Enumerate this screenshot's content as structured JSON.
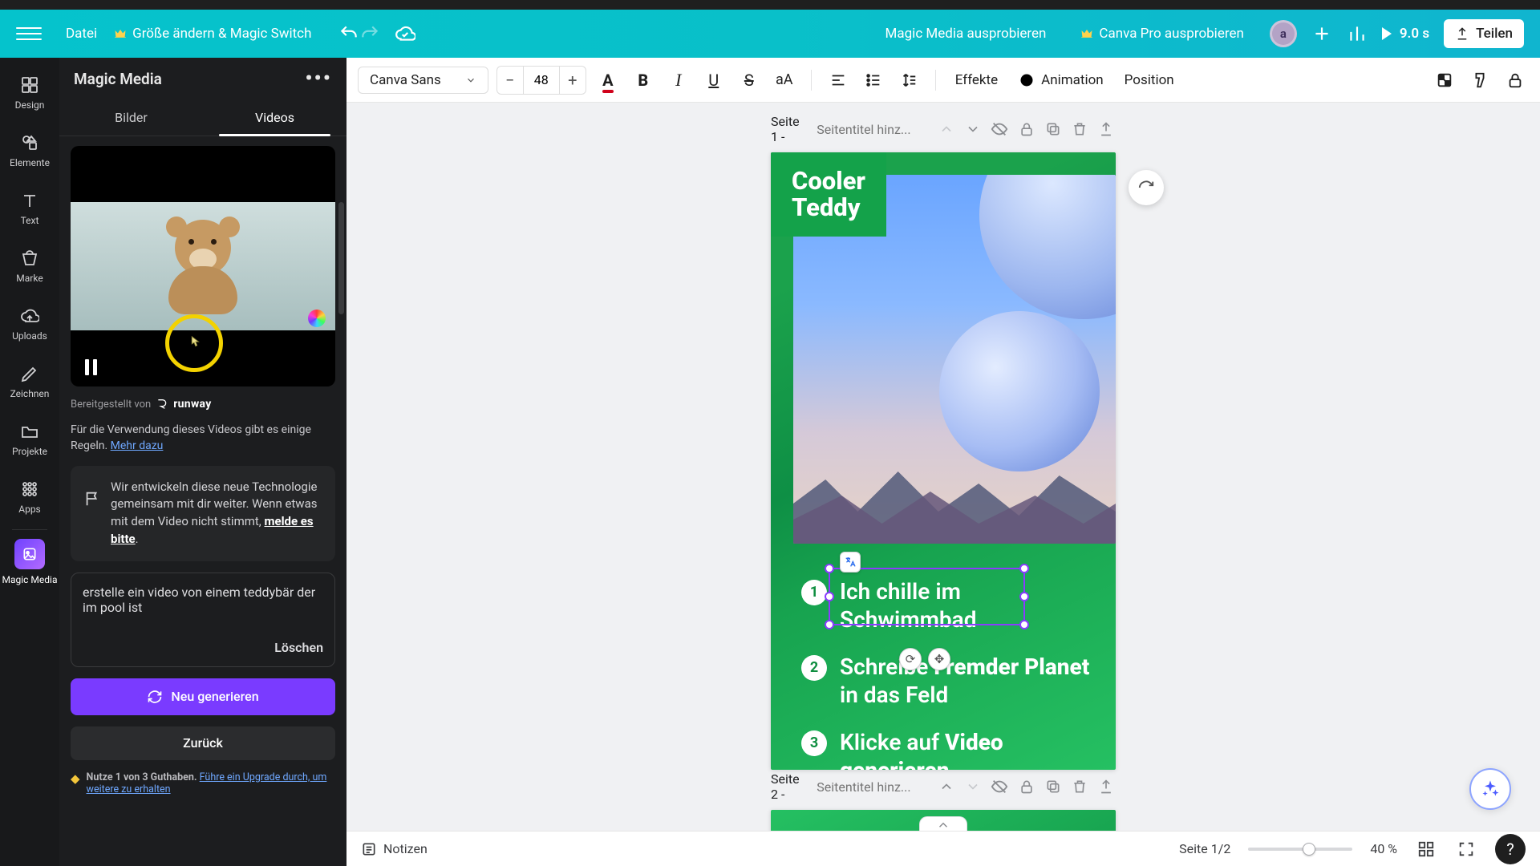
{
  "header": {
    "file": "Datei",
    "resize": "Größe ändern & Magic Switch",
    "doc_title": "Magic Media ausprobieren",
    "try_pro": "Canva Pro ausprobieren",
    "avatar_letter": "a",
    "present_duration": "9.0 s",
    "share": "Teilen"
  },
  "toolbar": {
    "font": "Canva Sans",
    "font_size": "48",
    "effects": "Effekte",
    "animation": "Animation",
    "position": "Position"
  },
  "rail": {
    "design": "Design",
    "elements": "Elemente",
    "text": "Text",
    "brand": "Marke",
    "uploads": "Uploads",
    "draw": "Zeichnen",
    "projects": "Projekte",
    "apps": "Apps",
    "magic_media": "Magic Media"
  },
  "panel": {
    "title": "Magic Media",
    "tab_images": "Bilder",
    "tab_videos": "Videos",
    "provided_by": "Bereitgestellt von",
    "provider": "runway",
    "rules_text": "Für die Verwendung dieses Videos gibt es einige Regeln.",
    "rules_link": "Mehr dazu",
    "feedback_text": "Wir entwickeln diese neue Technologie gemeinsam mit dir weiter. Wenn etwas mit dem Video nicht stimmt, ",
    "feedback_link": "melde es bitte",
    "prompt_value": "erstelle ein video von einem teddybär der im pool ist",
    "clear": "Löschen",
    "generate": "Neu generieren",
    "back": "Zurück",
    "credits_bold": "Nutze 1 von 3 Guthaben.",
    "credits_link": "Führe ein Upgrade durch, um weitere zu erhalten"
  },
  "pages": {
    "page1_label": "Seite 1",
    "page2_label": "Seite 2",
    "title_placeholder": "Seitentitel hinz...",
    "design_title_l1": "Cooler",
    "design_title_l2": "Teddy",
    "step1": "Ich chille im Schwimmbad",
    "step2_a": "Schreibe ",
    "step2_b": "Fremder Planet",
    "step2_c": " in das Feld",
    "step3_a": "Klicke auf ",
    "step3_b": "Video generieren"
  },
  "footer": {
    "notes": "Notizen",
    "page_counter": "Seite 1/2",
    "zoom": "40 %"
  }
}
